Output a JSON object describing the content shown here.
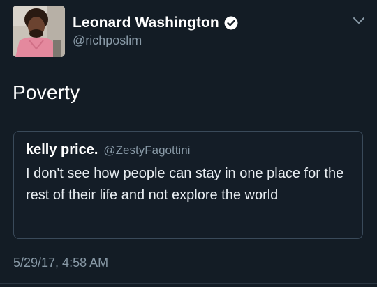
{
  "author": {
    "name": "Leonard Washington",
    "handle": "@richposlim",
    "verified": true,
    "avatar": "person-in-pink-shirt-avatar"
  },
  "tweet": {
    "text": "Poverty",
    "timestamp": "5/29/17, 4:58 AM"
  },
  "quoted_tweet": {
    "name": "kelly price.",
    "handle": "@ZestyFagottini",
    "text": "I don't see how people can stay in one place for the rest of their life and not explore the world"
  },
  "icons": {
    "verified": "verified-badge-icon",
    "menu": "chevron-down-icon"
  },
  "colors": {
    "background": "#131c25",
    "secondary_text": "#8899a6",
    "quote_border": "#3a4a5a"
  }
}
